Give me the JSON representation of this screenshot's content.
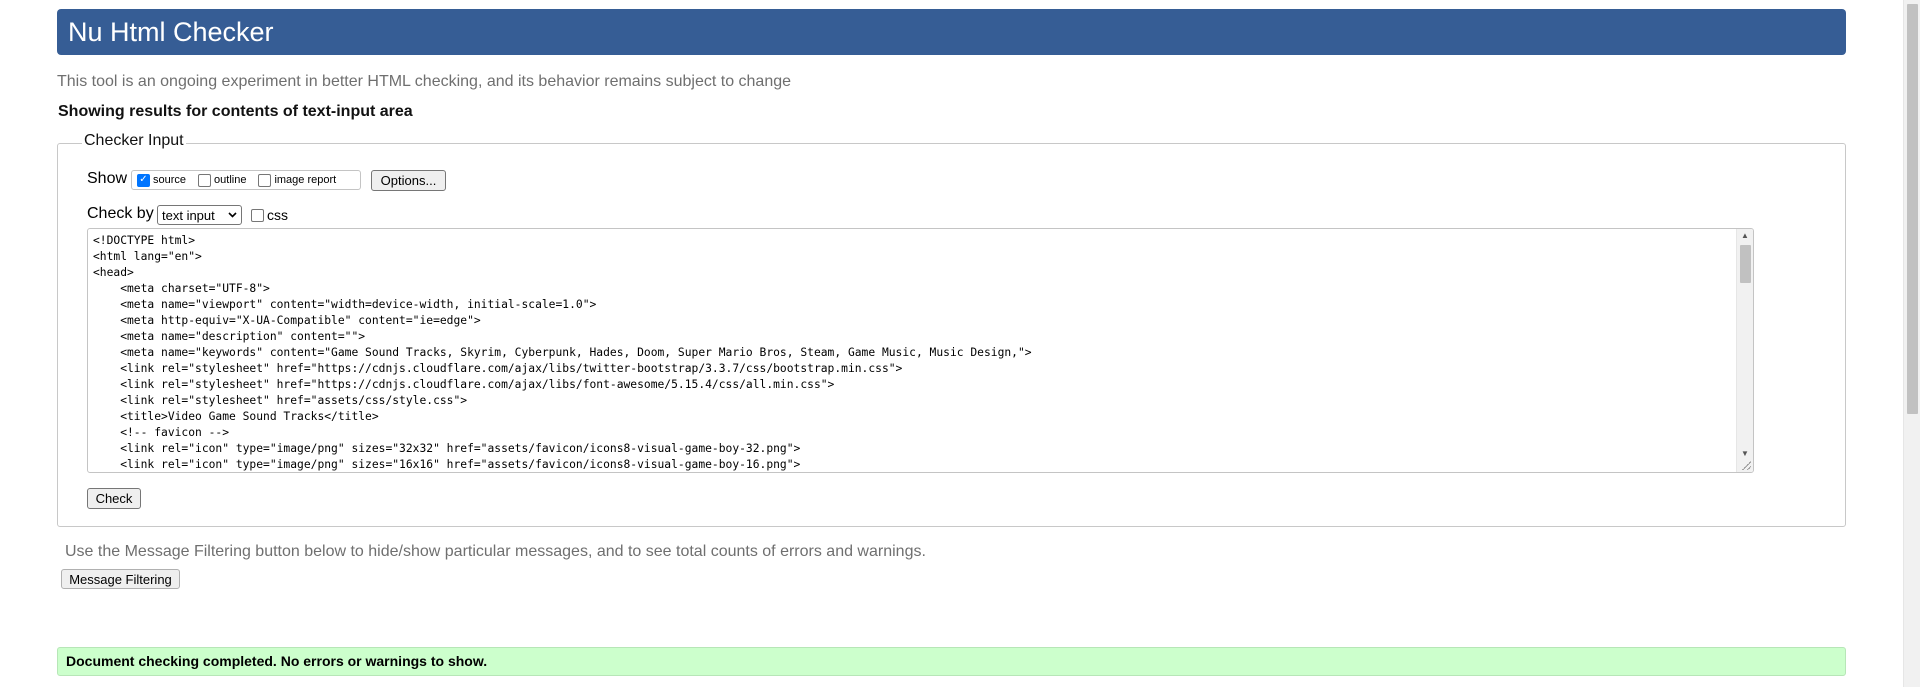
{
  "header": {
    "title": "Nu Html Checker"
  },
  "intro": {
    "tagline": "This tool is an ongoing experiment in better HTML checking, and its behavior remains subject to change",
    "showing": "Showing results for contents of text-input area"
  },
  "checker_input": {
    "legend": "Checker Input",
    "show_label": "Show",
    "show_options": [
      {
        "label": "source",
        "checked": true
      },
      {
        "label": "outline",
        "checked": false
      },
      {
        "label": "image report",
        "checked": false
      }
    ],
    "options_button": "Options...",
    "check_by_label": "Check by",
    "check_by_value": "text input",
    "css_label": "css",
    "source_lines": [
      "<!DOCTYPE html>",
      "<html lang=\"en\">",
      "<head>",
      "    <meta charset=\"UTF-8\">",
      "    <meta name=\"viewport\" content=\"width=device-width, initial-scale=1.0\">",
      "    <meta http-equiv=\"X-UA-Compatible\" content=\"ie=edge\">",
      "    <meta name=\"description\" content=\"\">",
      "    <meta name=\"keywords\" content=\"Game Sound Tracks, Skyrim, Cyberpunk, Hades, Doom, Super Mario Bros, Steam, Game Music, Music Design,\">",
      "    <link rel=\"stylesheet\" href=\"https://cdnjs.cloudflare.com/ajax/libs/twitter-bootstrap/3.3.7/css/bootstrap.min.css\">",
      "    <link rel=\"stylesheet\" href=\"https://cdnjs.cloudflare.com/ajax/libs/font-awesome/5.15.4/css/all.min.css\">",
      "    <link rel=\"stylesheet\" href=\"assets/css/style.css\">",
      "    <title>Video Game Sound Tracks</title>",
      "    <!-- favicon -->",
      "    <link rel=\"icon\" type=\"image/png\" sizes=\"32x32\" href=\"assets/favicon/icons8-visual-game-boy-32.png\">",
      "    <link rel=\"icon\" type=\"image/png\" sizes=\"16x16\" href=\"assets/favicon/icons8-visual-game-boy-16.png\">"
    ],
    "check_button": "Check"
  },
  "filtering": {
    "note": "Use the Message Filtering button below to hide/show particular messages, and to see total counts of errors and warnings.",
    "button": "Message Filtering"
  },
  "result": {
    "message": "Document checking completed. No errors or warnings to show."
  },
  "colors": {
    "header_bg": "#365d95",
    "success_bg": "#ccffcc",
    "checkbox_accent": "#0075ff"
  }
}
